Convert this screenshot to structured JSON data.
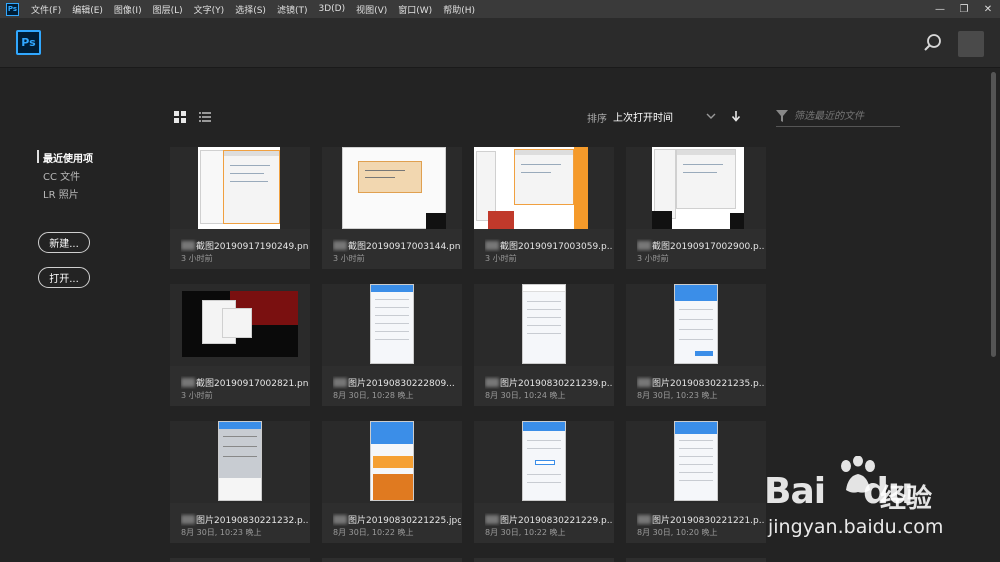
{
  "menubar": {
    "app_icon": "Ps",
    "items": [
      "文件(F)",
      "编辑(E)",
      "图像(I)",
      "图层(L)",
      "文字(Y)",
      "选择(S)",
      "滤镜(T)",
      "3D(D)",
      "视图(V)",
      "窗口(W)",
      "帮助(H)"
    ],
    "window_controls": [
      "—",
      "❐",
      "✕"
    ]
  },
  "header": {
    "logo": "Ps"
  },
  "nav": {
    "items": [
      {
        "label": "最近使用项",
        "active": true
      },
      {
        "label": "CC 文件",
        "active": false
      },
      {
        "label": "LR 照片",
        "active": false
      }
    ],
    "new_button": "新建...",
    "open_button": "打开..."
  },
  "toolbar": {
    "sort_label": "排序",
    "sort_value": "上次打开时间",
    "filter_placeholder": "筛选最近的文件"
  },
  "files": [
    {
      "name": "截图20190917190249.png",
      "time": "3 小时前",
      "thumb": "win"
    },
    {
      "name": "截图20190917003144.png",
      "time": "3 小时前",
      "thumb": "dialog"
    },
    {
      "name": "截图20190917003059.p...",
      "time": "3 小时前",
      "thumb": "win"
    },
    {
      "name": "截图20190917002900.p...",
      "time": "3 小时前",
      "thumb": "win"
    },
    {
      "name": "截图20190917002821.png",
      "time": "3 小时前",
      "thumb": "desktop"
    },
    {
      "name": "图片20190830222809...",
      "time": "8月 30日, 10:28 晚上",
      "thumb": "phone"
    },
    {
      "name": "图片20190830221239.p...",
      "time": "8月 30日, 10:24 晚上",
      "thumb": "phone"
    },
    {
      "name": "图片20190830221235.p...",
      "time": "8月 30日, 10:23 晚上",
      "thumb": "phone"
    },
    {
      "name": "图片20190830221232.p...",
      "time": "8月 30日, 10:23 晚上",
      "thumb": "phone"
    },
    {
      "name": "图片20190830221225.jpg",
      "time": "8月 30日, 10:22 晚上",
      "thumb": "phone-color"
    },
    {
      "name": "图片20190830221229.p...",
      "time": "8月 30日, 10:22 晚上",
      "thumb": "phone"
    },
    {
      "name": "图片20190830221221.p...",
      "time": "8月 30日, 10:20 晚上",
      "thumb": "phone"
    }
  ],
  "watermark": {
    "brand": "Bai",
    "brand2": "du",
    "site": "经验",
    "url": "jingyan.baidu.com"
  },
  "colors": {
    "accent": "#31a8ff",
    "background": "#232323",
    "card": "#2e2e2e"
  }
}
